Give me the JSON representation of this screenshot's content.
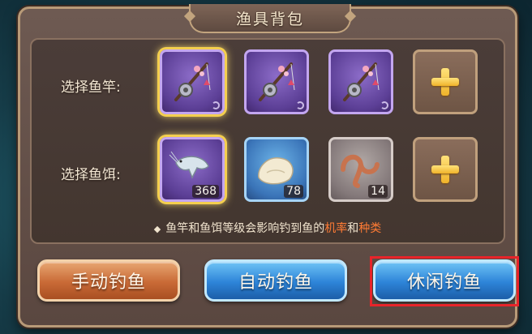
{
  "title": "渔具背包",
  "rods": {
    "label": "选择鱼竿:",
    "slots": [
      {
        "icon": "fishing-rod-icon",
        "rarity": "purple",
        "selected": true
      },
      {
        "icon": "fishing-rod-icon",
        "rarity": "purple",
        "selected": false
      },
      {
        "icon": "fishing-rod-icon",
        "rarity": "purple",
        "selected": false
      }
    ],
    "add_icon": "plus-icon"
  },
  "baits": {
    "label": "选择鱼饵:",
    "slots": [
      {
        "icon": "shrimp-icon",
        "rarity": "purple",
        "count": "368",
        "selected": true
      },
      {
        "icon": "dough-icon",
        "rarity": "blue",
        "count": "78",
        "selected": false
      },
      {
        "icon": "worm-icon",
        "rarity": "gray",
        "count": "14",
        "selected": false
      }
    ],
    "add_icon": "plus-icon"
  },
  "hint": {
    "prefix": "鱼竿和鱼饵等级会影响钓到鱼的",
    "em1": "机率",
    "mid": "和",
    "em2": "种类"
  },
  "buttons": {
    "manual": "手动钓鱼",
    "auto": "自动钓鱼",
    "leisure": "休闲钓鱼"
  },
  "colors": {
    "accent_orange": "#ff7b34",
    "selected_gold": "#f4cf4e",
    "highlight_red": "#e8242a"
  }
}
